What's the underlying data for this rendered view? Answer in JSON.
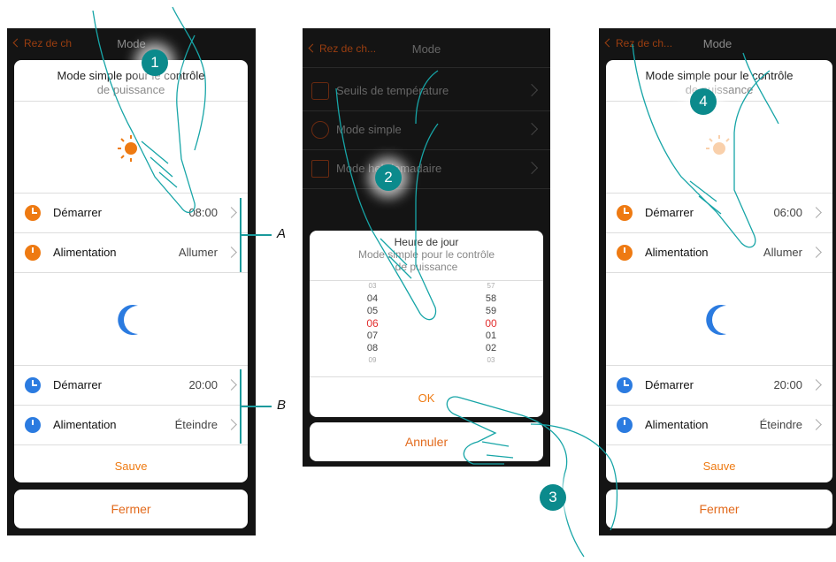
{
  "colors": {
    "accent_orange": "#ee7a12",
    "accent_blue": "#2b7be0",
    "teal": "#0b8a8c",
    "picker_selected": "#e23030"
  },
  "screen1": {
    "back_label": "Rez de ch",
    "title": "Mode",
    "card_title_line1": "Mode simple pour le contrôle",
    "card_title_line2": "de puissance",
    "day_rows": [
      {
        "label": "Démarrer",
        "value": "08:00",
        "icon": "clock-icon"
      },
      {
        "label": "Alimentation",
        "value": "Allumer",
        "icon": "power-icon"
      }
    ],
    "night_rows": [
      {
        "label": "Démarrer",
        "value": "20:00",
        "icon": "clock-icon"
      },
      {
        "label": "Alimentation",
        "value": "Éteindre",
        "icon": "power-icon"
      }
    ],
    "save_label": "Sauve",
    "close_label": "Fermer"
  },
  "screen2": {
    "back_label": "Rez de ch...",
    "title": "Mode",
    "menu_items": [
      {
        "label": "Seuils de température",
        "icon": "thermometer-icon"
      },
      {
        "label": "Mode simple",
        "icon": "check-circle-icon"
      },
      {
        "label": "Mode hebdomadaire",
        "icon": "calendar-icon"
      }
    ],
    "dialog_title": "Heure de jour",
    "dialog_sub_line1": "Mode simple pour le contrôle",
    "dialog_sub_line2": "de puissance",
    "hours": [
      "03",
      "04",
      "05",
      "06",
      "07",
      "08",
      "09"
    ],
    "minutes": [
      "57",
      "58",
      "59",
      "00",
      "01",
      "02",
      "03"
    ],
    "selected_hour": "06",
    "selected_minute": "00",
    "ok_label": "OK",
    "cancel_label": "Annuler"
  },
  "screen3": {
    "back_label": "Rez de ch...",
    "title": "Mode",
    "card_title_line1": "Mode simple pour le contrôle",
    "card_title_line2": "de puissance",
    "day_rows": [
      {
        "label": "Démarrer",
        "value": "06:00",
        "icon": "clock-icon"
      },
      {
        "label": "Alimentation",
        "value": "Allumer",
        "icon": "power-icon"
      }
    ],
    "night_rows": [
      {
        "label": "Démarrer",
        "value": "20:00",
        "icon": "clock-icon"
      },
      {
        "label": "Alimentation",
        "value": "Éteindre",
        "icon": "power-icon"
      }
    ],
    "save_label": "Sauve",
    "close_label": "Fermer"
  },
  "annotations": {
    "step1": "1",
    "step2": "2",
    "step3": "3",
    "step4": "4",
    "bracket_a": "A",
    "bracket_b": "B"
  }
}
